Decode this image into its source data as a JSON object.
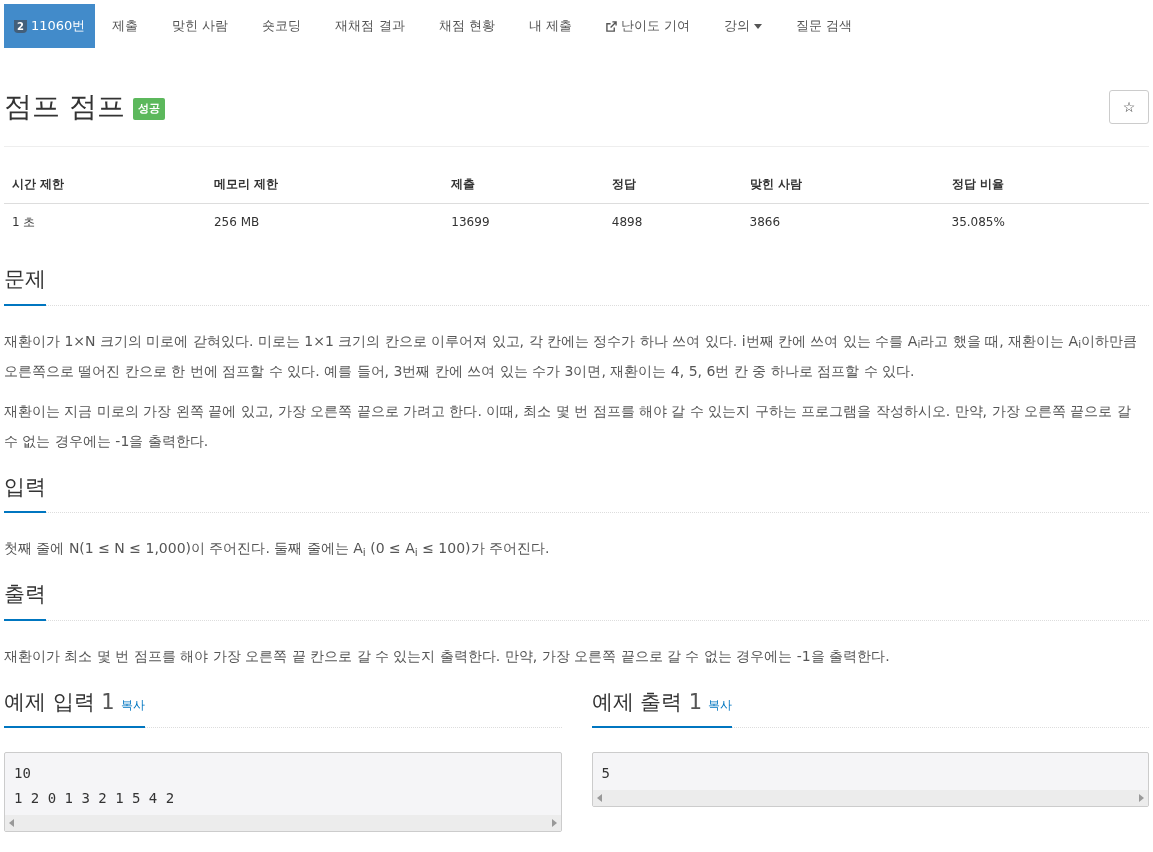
{
  "nav": [
    {
      "kind": "badge",
      "badge": "2",
      "label": "11060번",
      "selected": true
    },
    {
      "kind": "plain",
      "label": "제출",
      "selected": false
    },
    {
      "kind": "plain",
      "label": "맞힌 사람",
      "selected": false
    },
    {
      "kind": "plain",
      "label": "숏코딩",
      "selected": false
    },
    {
      "kind": "plain",
      "label": "재채점 결과",
      "selected": false
    },
    {
      "kind": "plain",
      "label": "채점 현황",
      "selected": false
    },
    {
      "kind": "plain",
      "label": "내 제출",
      "selected": false
    },
    {
      "kind": "external",
      "label": "난이도 기여",
      "selected": false
    },
    {
      "kind": "dropdown",
      "label": "강의",
      "selected": false
    },
    {
      "kind": "plain",
      "label": "질문 검색",
      "selected": false
    }
  ],
  "title": "점프 점프",
  "status_label": "성공",
  "star_button": "☆",
  "info_table": {
    "columns": [
      "시간 제한",
      "메모리 제한",
      "제출",
      "정답",
      "맞힌 사람",
      "정답 비율"
    ],
    "rows": [
      [
        "1 초",
        "256 MB",
        "13699",
        "4898",
        "3866",
        "35.085%"
      ]
    ]
  },
  "sections": [
    {
      "heading": "문제",
      "paragraphs": [
        "재환이가 1×N 크기의 미로에 갇혀있다. 미로는 1×1 크기의 칸으로 이루어져 있고, 각 칸에는 정수가 하나 쓰여 있다. i번째 칸에 쓰여 있는 수를 A$_{i}$라고 했을 때, 재환이는 A$_{i}$이하만큼 오른쪽으로 떨어진 칸으로 한 번에 점프할 수 있다. 예를 들어, 3번째 칸에 쓰여 있는 수가 3이면, 재환이는 4, 5, 6번 칸 중 하나로 점프할 수 있다.",
        "재환이는 지금 미로의 가장 왼쪽 끝에 있고, 가장 오른쪽 끝으로 가려고 한다. 이때, 최소 몇 번 점프를 해야 갈 수 있는지 구하는 프로그램을 작성하시오. 만약, 가장 오른쪽 끝으로 갈 수 없는 경우에는 -1을 출력한다."
      ]
    },
    {
      "heading": "입력",
      "paragraphs": [
        "첫째 줄에 N(1 ≤ N ≤ 1,000)이 주어진다. 둘째 줄에는 A$_{i}$ (0 ≤ A$_{i}$ ≤ 100)가 주어진다."
      ]
    },
    {
      "heading": "출력",
      "paragraphs": [
        "재환이가 최소 몇 번 점프를 해야 가장 오른쪽 끝 칸으로 갈 수 있는지 출력한다. 만약, 가장 오른쪽 끝으로 갈 수 없는 경우에는 -1을 출력한다."
      ]
    }
  ],
  "samples": [
    {
      "heading": "예제 입력",
      "number": "1",
      "copy_link": "복사",
      "lines": [
        "10",
        "1 2 0 1 3 2 1 5 4 2"
      ]
    },
    {
      "heading": "예제 출력",
      "number": "1",
      "copy_link": "복사",
      "lines": [
        "5"
      ]
    }
  ]
}
